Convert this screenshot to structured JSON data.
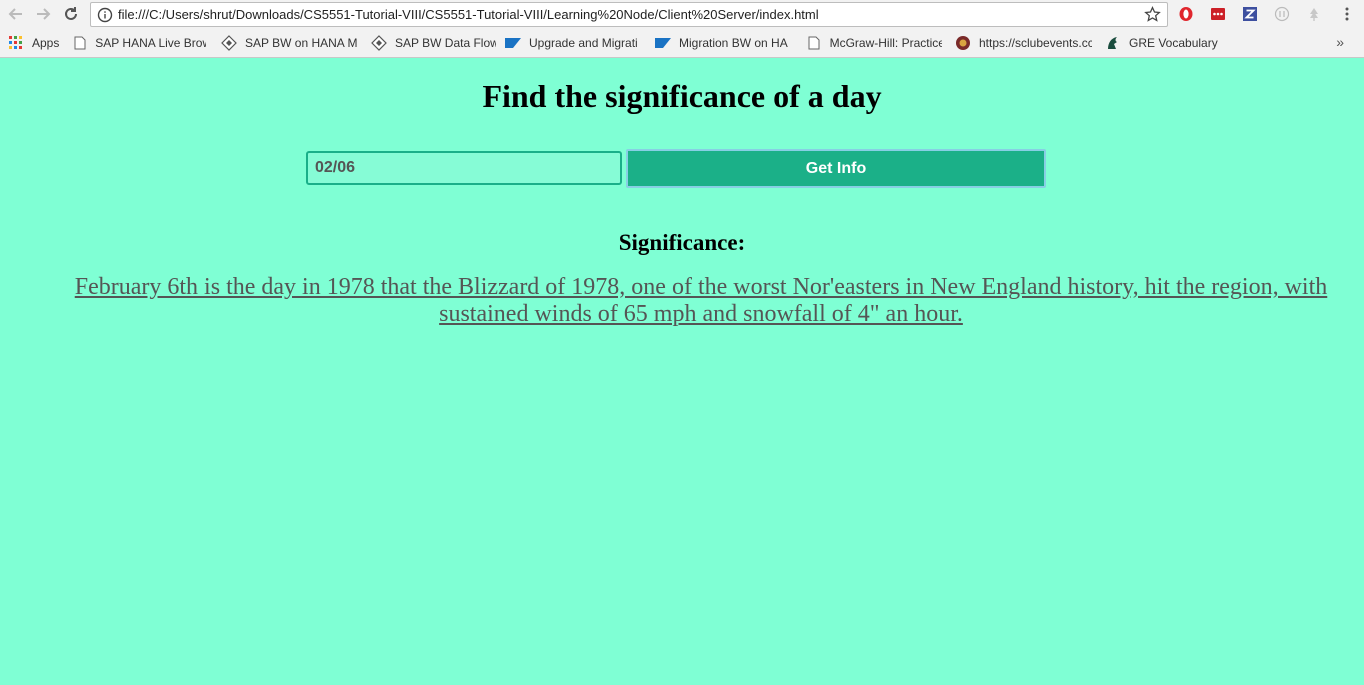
{
  "browser": {
    "url": "file:///C:/Users/shrut/Downloads/CS5551-Tutorial-VIII/CS5551-Tutorial-VIII/Learning%20Node/Client%20Server/index.html",
    "bookmarks": [
      {
        "label": "Apps",
        "icon": "apps-grid-icon"
      },
      {
        "label": "SAP HANA Live Brow",
        "icon": "page-icon"
      },
      {
        "label": "SAP BW on HANA Mi",
        "icon": "diamond-icon"
      },
      {
        "label": "SAP BW Data Flow",
        "icon": "diamond-icon"
      },
      {
        "label": "Upgrade and Migrati",
        "icon": "sap-icon"
      },
      {
        "label": "Migration BW on HA",
        "icon": "sap-icon"
      },
      {
        "label": "McGraw-Hill: Practice",
        "icon": "page-icon"
      },
      {
        "label": "https://sclubevents.cc",
        "icon": "club-icon"
      },
      {
        "label": "GRE Vocabulary",
        "icon": "spartan-icon"
      }
    ],
    "more_label": "»"
  },
  "page": {
    "title": "Find the significance of a day",
    "date_value": "02/06",
    "button_label": "Get Info",
    "significance_heading": "Significance:",
    "significance_text": "February 6th is the day in 1978 that the Blizzard of 1978, one of the worst Nor'easters in New England history, hit the region, with sustained winds of 65 mph and snowfall of 4\" an hour."
  },
  "colors": {
    "page_background": "#7fffd4",
    "button_background": "#1bb088",
    "input_border": "#1aaf89"
  }
}
